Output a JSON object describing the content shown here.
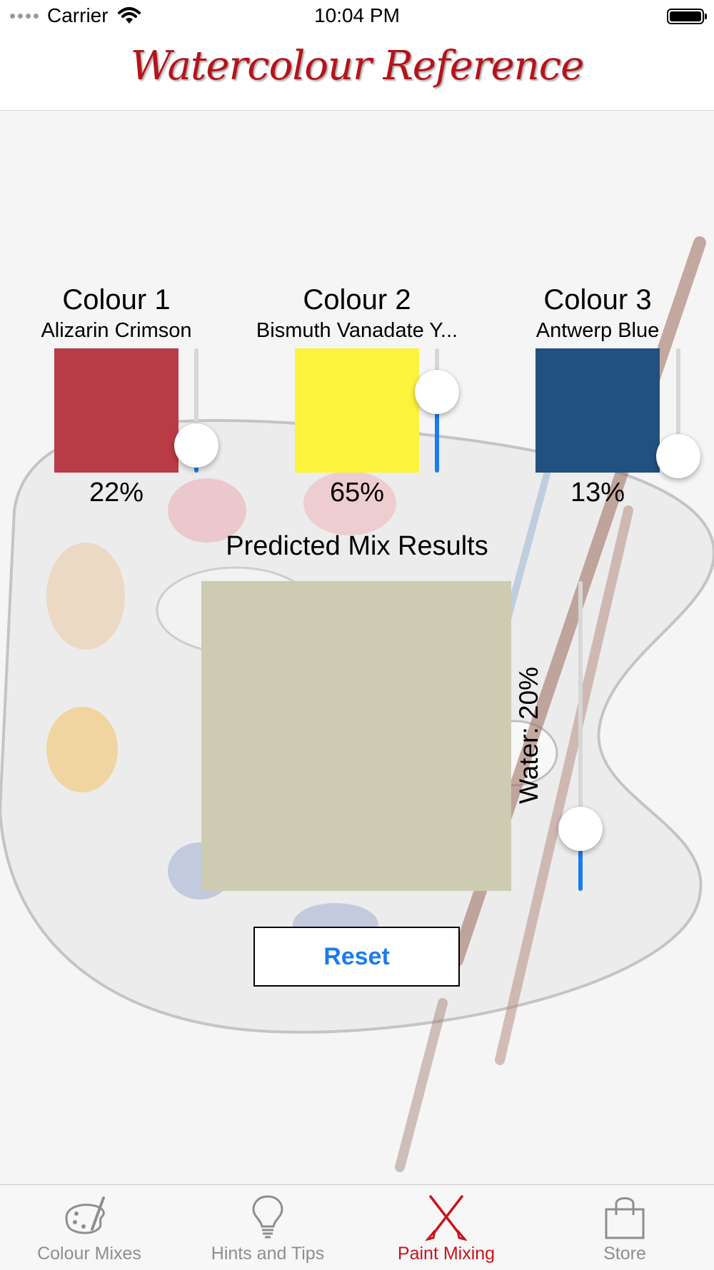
{
  "status_bar": {
    "carrier": "Carrier",
    "time": "10:04 PM"
  },
  "header": {
    "title": "Watercolour Reference"
  },
  "colours": [
    {
      "title": "Colour 1",
      "name": "Alizarin Crimson",
      "swatch_color": "#b93b46",
      "percent_label": "22%",
      "slider_level": 0.22
    },
    {
      "title": "Colour 2",
      "name": "Bismuth Vanadate Y...",
      "swatch_color": "#fcf43c",
      "percent_label": "65%",
      "slider_level": 0.65
    },
    {
      "title": "Colour 3",
      "name": "Antwerp Blue",
      "swatch_color": "#21517f",
      "percent_label": "13%",
      "slider_level": 0.13
    }
  ],
  "mix": {
    "label": "Predicted Mix Results",
    "result_color": "#cdcbb1"
  },
  "water": {
    "label": "Water: 20%",
    "slider_level": 0.2
  },
  "reset_label": "Reset",
  "accent_color": "#1a7cf0",
  "tabs": [
    {
      "label": "Colour Mixes",
      "icon": "palette-icon",
      "active": false
    },
    {
      "label": "Hints and Tips",
      "icon": "lightbulb-icon",
      "active": false
    },
    {
      "label": "Paint Mixing",
      "icon": "crossed-brushes-icon",
      "active": true
    },
    {
      "label": "Store",
      "icon": "shopping-bag-icon",
      "active": false
    }
  ]
}
